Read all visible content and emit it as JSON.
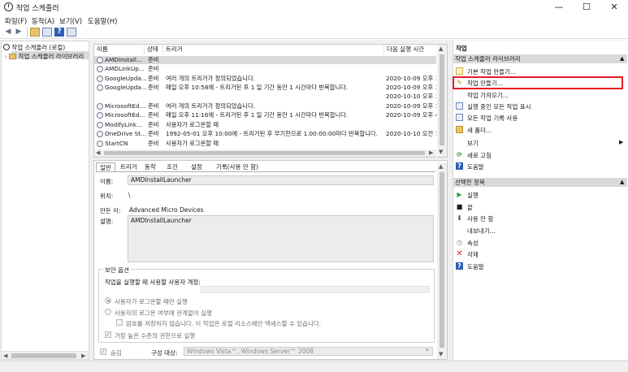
{
  "window": {
    "title": "작업 스케줄러",
    "minimize": "—",
    "maximize": "☐",
    "close": "✕"
  },
  "menu": [
    "파일(F)",
    "동작(A)",
    "보기(V)",
    "도움말(H)"
  ],
  "tree": {
    "root": "작업 스케줄러 (로컬)",
    "library": "작업 스케줄러 라이브러리"
  },
  "tasks": {
    "headers": [
      "이름",
      "상태",
      "트리거",
      "다음 실행 시간"
    ],
    "rows": [
      {
        "name": "AMDInstall...",
        "status": "준비",
        "trigger": "",
        "next": ""
      },
      {
        "name": "AMDLinkUp...",
        "status": "준비",
        "trigger": "",
        "next": ""
      },
      {
        "name": "GoogleUpda...",
        "status": "준비",
        "trigger": "여러 개의 트리거가 정의되었습니다.",
        "next": "2020-10-09 오후 10"
      },
      {
        "name": "GoogleUpda...",
        "status": "준비",
        "trigger": "매일 오후 10:58에 - 트리거된 후 1 일 기간 동안 1 시간마다 반복합니다.",
        "next": "2020-10-09 오후 3:"
      },
      {
        "name": "",
        "status": "",
        "trigger": "",
        "next": "2020-10-10 오후 3:"
      },
      {
        "name": "MicrosoftEd...",
        "status": "준비",
        "trigger": "여러 개의 트리거가 정의되었습니다.",
        "next": "2020-10-09 오후 11"
      },
      {
        "name": "MicrosoftEd...",
        "status": "준비",
        "trigger": "매일 오후 11:16에 - 트리거된 후 1 일 기간 동안 1 시간마다 반복합니다.",
        "next": "2020-10-09 오후 4:"
      },
      {
        "name": "ModifyLink...",
        "status": "준비",
        "trigger": "사용자가 로그온할 때",
        "next": ""
      },
      {
        "name": "OneDrive St...",
        "status": "준비",
        "trigger": "1992-05-01 오후 10:00에 - 트리거된 후 무기한으로 1.00:00:00마다 반복합니다.",
        "next": "2020-10-10 오전 11"
      },
      {
        "name": "StartCN",
        "status": "준비",
        "trigger": "사용자가 로그온할 때",
        "next": ""
      }
    ]
  },
  "detail": {
    "tabs": [
      "일반",
      "트리거",
      "동작",
      "조건",
      "설정",
      "기록(사용 안 함)"
    ],
    "name_label": "이름:",
    "name_value": "AMDInstallLauncher",
    "location_label": "위치:",
    "location_value": "\\",
    "author_label": "만든 이:",
    "author_value": "Advanced Micro Devices",
    "description_label": "설명:",
    "description_value": "AMDInstallLauncher",
    "security_group": "보안 옵션",
    "run_as_label": "작업을 실행할 때 사용할 사용자 계정:",
    "opt_logon_only": "사용자가 로그온할 때만 실행",
    "opt_always": "사용자의 로그온 여부에 관계없이 실행",
    "opt_no_password": "암호를 저장하지 않습니다. 이 작업은 로컬 리소스에만 액세스할 수 있습니다.",
    "opt_highest": "가장 높은 수준의 권한으로 실행",
    "hidden_label": "숨김",
    "configure_label": "구성 대상:",
    "configure_value": "Windows Vista™, Windows Server™ 2008"
  },
  "actions": {
    "header": "작업",
    "library_section": "작업 스케줄러 라이브러리",
    "library_items": [
      "기본 작업 만들기...",
      "작업 만들기...",
      "작업 가져오기...",
      "실행 중인 모든 작업 표시",
      "모든 작업 기록 사용",
      "새 폴더...",
      "보기",
      "새로 고침",
      "도움말"
    ],
    "selected_section": "선택한 항목",
    "selected_items": [
      "실행",
      "끝",
      "사용 안 함",
      "내보내기...",
      "속성",
      "삭제",
      "도움말"
    ]
  },
  "colors": {
    "highlight_border": "#e41e26",
    "section_bg": "#d9d9d9"
  }
}
